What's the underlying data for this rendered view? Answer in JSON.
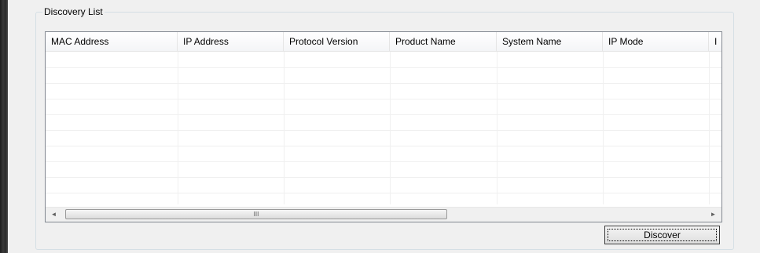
{
  "group": {
    "title": "Discovery List"
  },
  "listview": {
    "columns": [
      "MAC Address",
      "IP Address",
      "Protocol Version",
      "Product Name",
      "System Name",
      "IP Mode",
      "I"
    ],
    "rows": []
  },
  "scrollbar": {
    "left_arrow": "◄",
    "right_arrow": "►",
    "grip": "III"
  },
  "buttons": {
    "discover_label": "Discover"
  }
}
